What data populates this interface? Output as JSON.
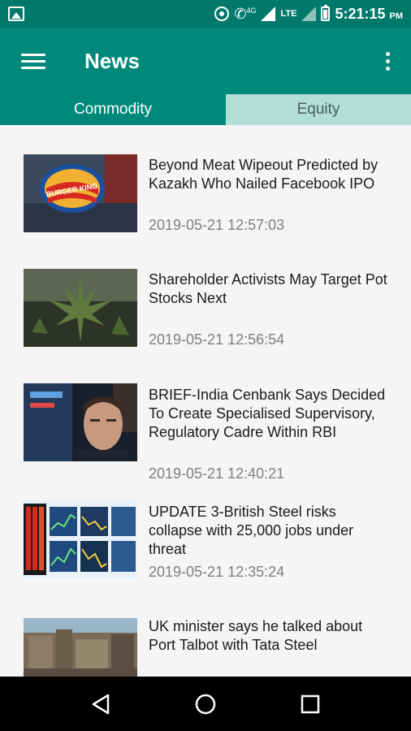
{
  "status_bar": {
    "time": "5:21:15",
    "time_suffix": "PM",
    "network_top": "LTE",
    "network_call": "4G",
    "icons": [
      "gallery-icon",
      "data-saver-icon",
      "wifi-calling-icon",
      "signal-icon",
      "battery-icon"
    ]
  },
  "app_bar": {
    "title": "News",
    "menu_icon": "hamburger-menu-icon",
    "overflow_icon": "more-vert-icon"
  },
  "tabs": [
    {
      "label": "Commodity",
      "selected": true
    },
    {
      "label": "Equity",
      "selected": false
    }
  ],
  "news": [
    {
      "headline": "Beyond Meat Wipeout Predicted by Kazakh Who Nailed Facebook IPO",
      "timestamp": "2019-05-21 12:57:03",
      "thumb_text": "BURGER KING"
    },
    {
      "headline": "Shareholder Activists May Target Pot Stocks Next",
      "timestamp": "2019-05-21 12:56:54"
    },
    {
      "headline": "BRIEF-India Cenbank Says Decided To Create Specialised Supervisory, Regulatory Cadre Within RBI",
      "timestamp": "2019-05-21 12:40:21"
    },
    {
      "headline": "UPDATE 3-British Steel risks collapse with 25,000 jobs under threat",
      "timestamp": "2019-05-21 12:35:24"
    },
    {
      "headline": "UK minister says he talked about Port Talbot with Tata Steel",
      "timestamp": ""
    }
  ],
  "colors": {
    "primary": "#00897b",
    "primary_dark": "#00796b",
    "tab_inactive": "#b2dfd5"
  },
  "nav_bar": {
    "back_icon": "back-triangle-icon",
    "home_icon": "home-circle-icon",
    "recents_icon": "recents-square-icon"
  }
}
